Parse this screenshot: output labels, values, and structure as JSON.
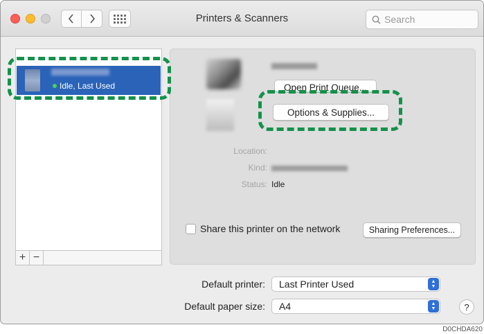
{
  "window": {
    "title": "Printers & Scanners"
  },
  "toolbar": {
    "back_icon": "chevron-left-icon",
    "forward_icon": "chevron-right-icon",
    "grid_icon": "grid-icon"
  },
  "search": {
    "placeholder": "Search"
  },
  "printer_list": {
    "items": [
      {
        "name": "",
        "status": "Idle, Last Used",
        "status_color": "#4bd05c"
      }
    ],
    "add_label": "+",
    "remove_label": "−"
  },
  "details": {
    "open_queue_label": "Open Print Queue...",
    "options_label": "Options & Supplies...",
    "location_label": "Location:",
    "location_value": "",
    "kind_label": "Kind:",
    "status_label": "Status:",
    "status_value": "Idle",
    "share_label": "Share this printer on the network",
    "share_checked": false,
    "sharing_prefs_label": "Sharing Preferences..."
  },
  "defaults": {
    "printer_label": "Default printer:",
    "printer_value": "Last Printer Used",
    "paper_label": "Default paper size:",
    "paper_value": "A4"
  },
  "help_label": "?",
  "figure_code": "D0CHDA620",
  "colors": {
    "selection": "#2a63b8",
    "callout": "#14914a",
    "stepper": "#2f6fd8"
  }
}
